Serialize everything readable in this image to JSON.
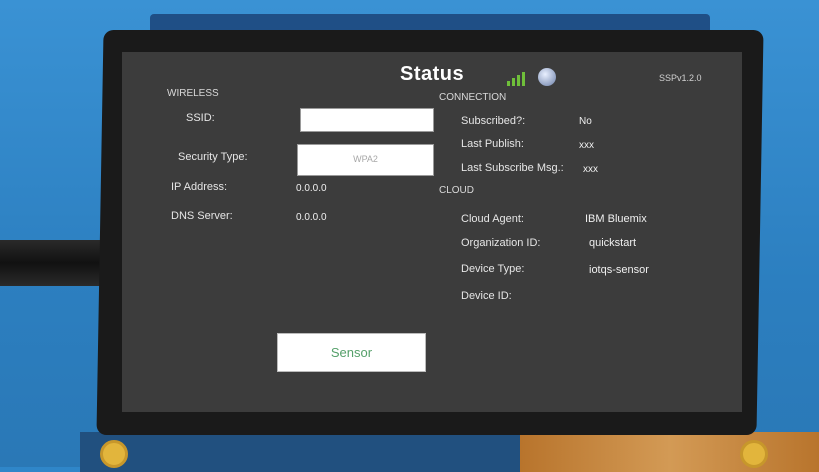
{
  "header": {
    "title": "Status",
    "version": "SSPv1.2.0",
    "icons": [
      "signal-icon",
      "globe-icon"
    ]
  },
  "wireless": {
    "section_label": "WIRELESS",
    "ssid_label": "SSID:",
    "ssid_value": "",
    "security_label": "Security Type:",
    "security_value": "WPA2",
    "ip_label": "IP Address:",
    "ip_value": "0.0.0.0",
    "dns_label": "DNS Server:",
    "dns_value": "0.0.0.0"
  },
  "connection": {
    "section_label": "CONNECTION",
    "subscribed_label": "Subscribed?:",
    "subscribed_value": "No",
    "last_publish_label": "Last Publish:",
    "last_publish_value": "xxx",
    "last_subscribe_label": "Last Subscribe Msg.:",
    "last_subscribe_value": "xxx"
  },
  "cloud": {
    "section_label": "CLOUD",
    "agent_label": "Cloud Agent:",
    "agent_value": "IBM Bluemix",
    "org_label": "Organization ID:",
    "org_value": "quickstart",
    "device_type_label": "Device Type:",
    "device_type_value": "iotqs-sensor",
    "device_id_label": "Device ID:",
    "device_id_value": ""
  },
  "footer": {
    "sensor_button_label": "Sensor"
  },
  "colors": {
    "screen_background": "#3c3c3c",
    "button_text": "#55a06a",
    "signal_bars": "#6fbf3a"
  }
}
